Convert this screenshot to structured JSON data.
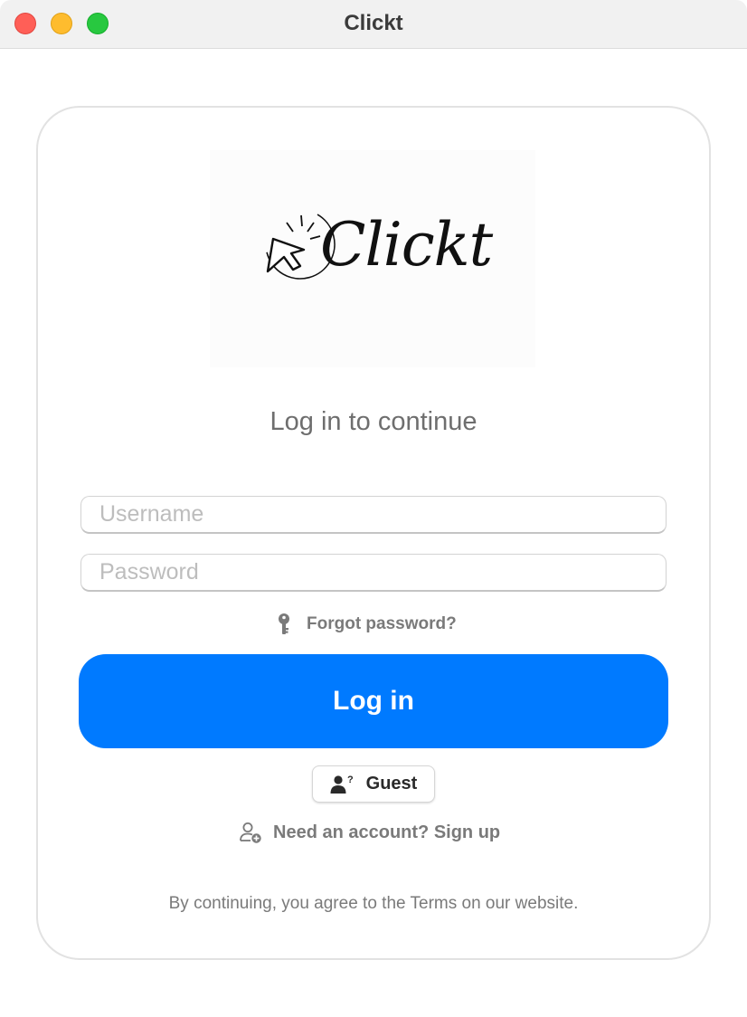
{
  "window": {
    "title": "Clickt"
  },
  "logo": {
    "wordmark": "Clickt"
  },
  "login": {
    "heading": "Log in to continue",
    "username_placeholder": "Username",
    "password_placeholder": "Password",
    "forgot_label": "Forgot password?",
    "login_label": "Log in",
    "guest_label": "Guest",
    "signup_label": "Need an account? Sign up",
    "terms": "By continuing, you agree to the Terms on our website."
  },
  "icons": {
    "forgot": "key-icon",
    "guest": "person-question-icon",
    "signup": "person-add-icon"
  },
  "colors": {
    "accent": "#007aff",
    "close": "#ff5f57",
    "minimize": "#febc2e",
    "maximize": "#28c840"
  }
}
